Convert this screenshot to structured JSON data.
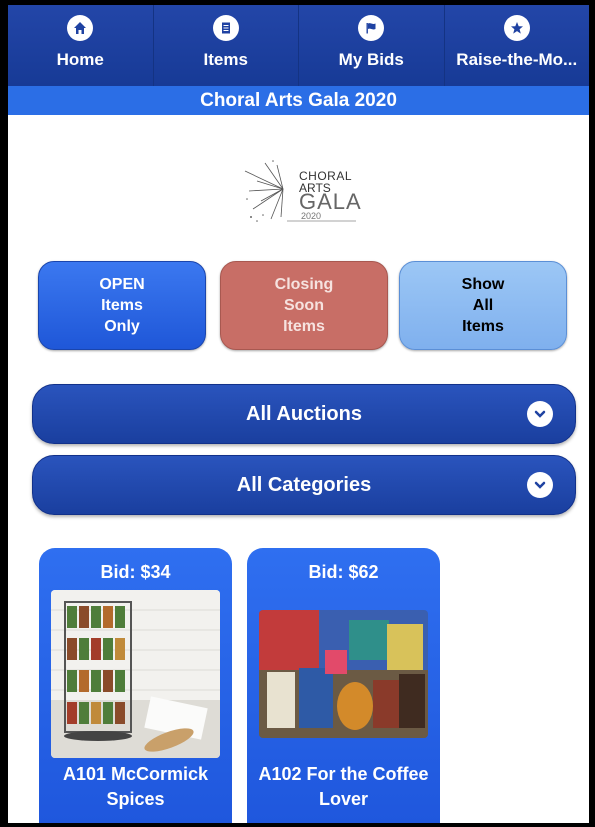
{
  "nav": {
    "items": [
      {
        "label": "Home",
        "icon": "home-icon"
      },
      {
        "label": "Items",
        "icon": "document-icon"
      },
      {
        "label": "My Bids",
        "icon": "flag-icon"
      },
      {
        "label": "Raise-the-Mo...",
        "icon": "star-icon"
      }
    ]
  },
  "header": {
    "title": "Choral Arts Gala 2020"
  },
  "logo": {
    "line1": "CHORAL",
    "line2": "ARTS",
    "line3": "GALA",
    "line4": "2020"
  },
  "filters": {
    "open": "OPEN\nItems\nOnly",
    "closing": "Closing\nSoon\nItems",
    "all": "Show\nAll\nItems"
  },
  "dropdowns": {
    "auctions": "All Auctions",
    "categories": "All Categories"
  },
  "items": [
    {
      "bid": "Bid: $34",
      "title": "A101 McCormick Spices"
    },
    {
      "bid": "Bid: $62",
      "title": "A102 For the Coffee Lover"
    }
  ],
  "colors": {
    "nav_bg": "#1f42a2",
    "subheader_bg": "#2b6ee6",
    "closing_btn": "#c86e66",
    "show_all_btn": "#8dbbf2",
    "card_bg": "#2a65ea"
  }
}
